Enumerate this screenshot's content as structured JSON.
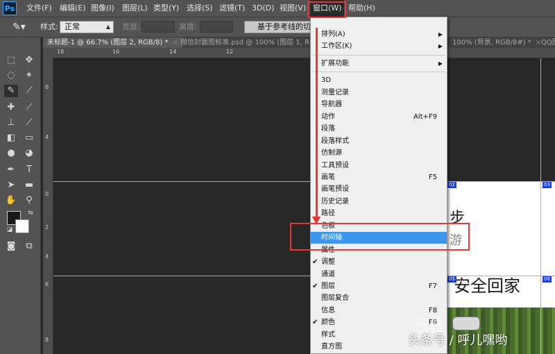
{
  "app": {
    "logo": "Ps"
  },
  "menubar": {
    "items": [
      "文件(F)",
      "编辑(E)",
      "图像(I)",
      "图层(L)",
      "类型(Y)",
      "选择(S)",
      "滤镜(T)",
      "3D(D)",
      "视图(V)",
      "窗口(W)",
      "帮助(H)"
    ],
    "active": "窗口(W)"
  },
  "options": {
    "style_label": "样式:",
    "style_value": "正常",
    "width_label": "宽度:",
    "height_label": "高度:",
    "refine_button": "基于参考线的切片"
  },
  "tabs": [
    "未标题-1 @ 66.7% (图层 2, RGB/8) *",
    "微信封面图标准.psd @ 100% (图层 1, RGB",
    "100% (背景, RGB/8#) *",
    "QQ图"
  ],
  "rulers": {
    "h": [
      "18",
      "16",
      "14",
      "12"
    ],
    "v": [
      "6",
      "4",
      "2",
      "0",
      "2",
      "4",
      "6",
      "8"
    ]
  },
  "document": {
    "text1": "步",
    "text2": "游",
    "text3": "安全回家",
    "slice_tags": [
      "02",
      "03",
      "05",
      "06"
    ]
  },
  "window_menu": {
    "items": [
      {
        "label": "排列(A)",
        "arrow": true
      },
      {
        "label": "工作区(K)",
        "arrow": true
      },
      {
        "label": "扩展功能",
        "arrow": true,
        "sep_before": true
      },
      {
        "label": "3D",
        "sep_before": true
      },
      {
        "label": "测量记录"
      },
      {
        "label": "导航器"
      },
      {
        "label": "动作",
        "shortcut": "Alt+F9"
      },
      {
        "label": "段落"
      },
      {
        "label": "段落样式"
      },
      {
        "label": "仿制源"
      },
      {
        "label": "工具预设"
      },
      {
        "label": "画笔",
        "shortcut": "F5"
      },
      {
        "label": "画笔预设"
      },
      {
        "label": "历史记录"
      },
      {
        "label": "路径"
      },
      {
        "label": "色板"
      },
      {
        "label": "时间轴",
        "highlighted": true
      },
      {
        "label": "属性"
      },
      {
        "label": "调整",
        "checked": true
      },
      {
        "label": "通道"
      },
      {
        "label": "图层",
        "checked": true,
        "shortcut": "F7"
      },
      {
        "label": "图层复合"
      },
      {
        "label": "信息",
        "shortcut": "F8"
      },
      {
        "label": "颜色",
        "checked": true,
        "shortcut": "F6"
      },
      {
        "label": "样式"
      },
      {
        "label": "直方图"
      }
    ],
    "check_glyph": "✔",
    "arrow_glyph": "▶"
  },
  "watermark": {
    "text": "头条号 / 呼儿嘿哟",
    "num": "58"
  },
  "colors": {
    "highlight": "#3c95ef",
    "annotation": "#e53935",
    "guide": "#4fd6d3"
  }
}
